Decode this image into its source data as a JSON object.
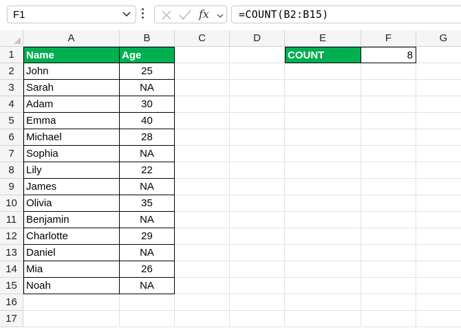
{
  "formula_bar": {
    "name_box": "F1",
    "cancel_icon": "cancel-icon",
    "enter_icon": "check-icon",
    "fx_label": "fx",
    "formula": "=COUNT(B2:B15)"
  },
  "columns": [
    "A",
    "B",
    "C",
    "D",
    "E",
    "F",
    "G"
  ],
  "rows": [
    "1",
    "2",
    "3",
    "4",
    "5",
    "6",
    "7",
    "8",
    "9",
    "10",
    "11",
    "12",
    "13",
    "14",
    "15",
    "16",
    "17"
  ],
  "table": {
    "header_name": "Name",
    "header_age": "Age",
    "header_color": "#00b050",
    "records": [
      {
        "name": "John",
        "age": "25"
      },
      {
        "name": "Sarah",
        "age": "NA"
      },
      {
        "name": "Adam",
        "age": "30"
      },
      {
        "name": "Emma",
        "age": "40"
      },
      {
        "name": "Michael",
        "age": "28"
      },
      {
        "name": "Sophia",
        "age": "NA"
      },
      {
        "name": "Lily",
        "age": "22"
      },
      {
        "name": "James",
        "age": "NA"
      },
      {
        "name": "Olivia",
        "age": "35"
      },
      {
        "name": "Benjamin",
        "age": "NA"
      },
      {
        "name": "Charlotte",
        "age": "29"
      },
      {
        "name": "Daniel",
        "age": "NA"
      },
      {
        "name": "Mia",
        "age": "26"
      },
      {
        "name": "Noah",
        "age": "NA"
      }
    ]
  },
  "summary": {
    "label": "COUNT",
    "value": "8"
  }
}
